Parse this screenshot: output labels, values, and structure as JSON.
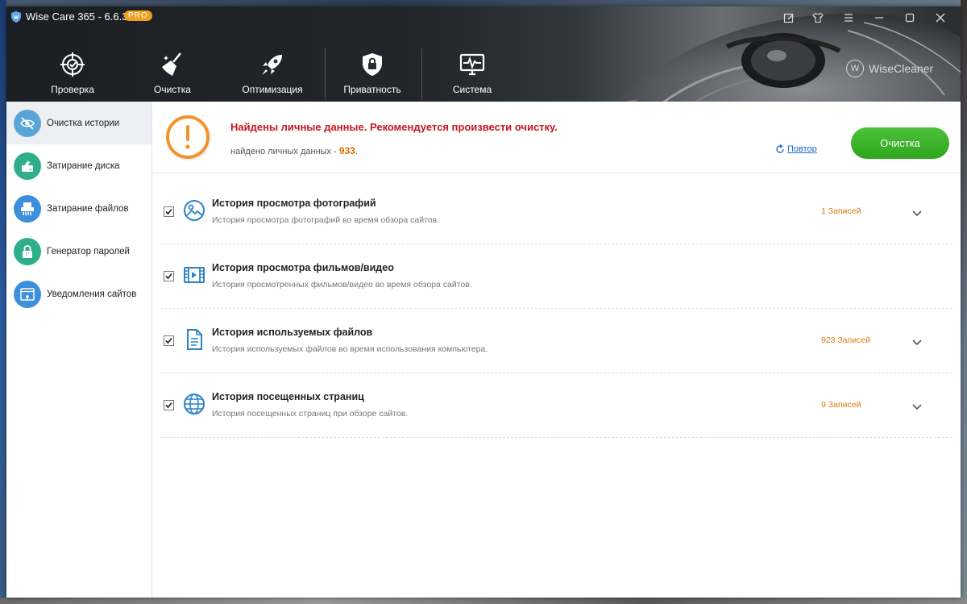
{
  "app": {
    "title": "Wise Care 365 - 6.6.3",
    "badge": "PRO",
    "brand": "WiseCleaner"
  },
  "nav": [
    {
      "label": "Проверка",
      "icon": "target-icon"
    },
    {
      "label": "Очистка",
      "icon": "broom-icon"
    },
    {
      "label": "Оптимизация",
      "icon": "rocket-icon"
    },
    {
      "label": "Приватность",
      "icon": "lock-shield-icon"
    },
    {
      "label": "Система",
      "icon": "monitor-pulse-icon"
    }
  ],
  "sidebar": {
    "items": [
      {
        "label": "Очистка истории",
        "icon": "eye-off-icon",
        "color": "#5aa5d8",
        "active": true
      },
      {
        "label": "Затирание диска",
        "icon": "disk-eraser-icon",
        "color": "#2fae8c"
      },
      {
        "label": "Затирание файлов",
        "icon": "shredder-icon",
        "color": "#3d8fdc"
      },
      {
        "label": "Генератор паролей",
        "icon": "password-lock-icon",
        "color": "#2fae8c"
      },
      {
        "label": "Уведомления сайтов",
        "icon": "browser-bell-icon",
        "color": "#3d8fdc"
      }
    ]
  },
  "alert": {
    "title": "Найдены личные данные. Рекомендуется произвести очистку.",
    "sub_label": "найдено личных данных -",
    "count": "933",
    "sub_suffix": ".",
    "retry": "Повтор",
    "clean_button": "Очистка"
  },
  "rows": [
    {
      "title": "История просмотра фотографий",
      "desc": "История просмотра фотографий во время обзора сайтов.",
      "count": "1 Записей",
      "icon": "photo-icon",
      "checked": true
    },
    {
      "title": "История просмотра фильмов/видео",
      "desc": "История просмотренных фильмов/видео во время обзора сайтов.",
      "count": "",
      "icon": "film-icon",
      "checked": true
    },
    {
      "title": "История используемых файлов",
      "desc": "История используемых файлов во время использования компьютера.",
      "count": "923 Записей",
      "icon": "document-icon",
      "checked": true
    },
    {
      "title": "История посещенных страниц",
      "desc": "История посещенных страниц при обзоре сайтов.",
      "count": "9 Записей",
      "icon": "globe-icon",
      "checked": true
    }
  ],
  "colors": {
    "accent": "#2b84c6",
    "alert_red": "#c8161d",
    "count_orange": "#d87a10",
    "clean_green": "#3db22b"
  }
}
